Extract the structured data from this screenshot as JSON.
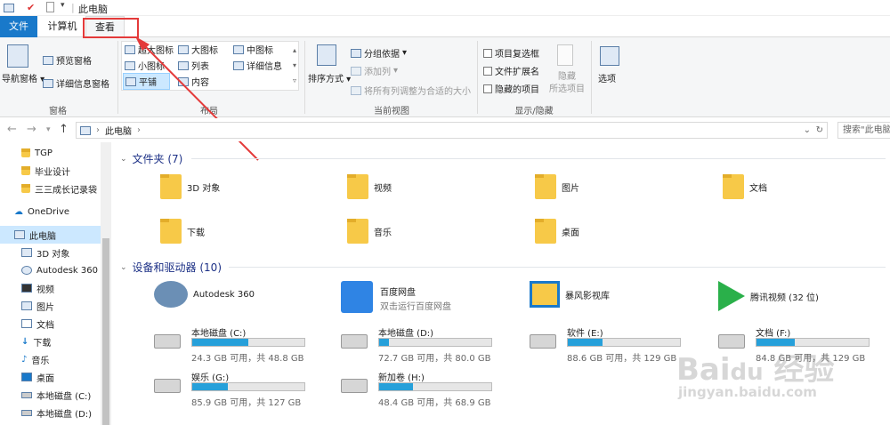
{
  "window": {
    "title": "此电脑"
  },
  "tabs": [
    {
      "label": "文件",
      "color": "#1979ca"
    },
    {
      "label": "计算机"
    },
    {
      "label": "查看"
    }
  ],
  "ribbon": {
    "pane": {
      "nav_pane": "导航窗格",
      "preview_pane": "预览窗格",
      "details_pane": "详细信息窗格",
      "label": "窗格"
    },
    "layout": {
      "items": [
        "超大图标",
        "大图标",
        "中图标",
        "小图标",
        "列表",
        "详细信息",
        "平铺",
        "内容"
      ],
      "label": "布局"
    },
    "current_view": {
      "sort_by": "排序方式",
      "group_by": "分组依据",
      "add_column": "添加列",
      "fit_columns": "将所有列调整为合适的大小",
      "label": "当前视图"
    },
    "show_hide": {
      "checkbox_items": "项目复选框",
      "extensions": "文件扩展名",
      "hidden_items": "隐藏的项目",
      "hide_selected_line1": "隐藏",
      "hide_selected_line2": "所选项目",
      "label": "显示/隐藏"
    },
    "options": "选项"
  },
  "address": {
    "path": "此电脑",
    "search_placeholder": "搜索\"此电脑\""
  },
  "sidebar": {
    "items": [
      {
        "label": "TGP"
      },
      {
        "label": "毕业设计"
      },
      {
        "label": "三三成长记录袋"
      },
      {
        "label": "OneDrive"
      },
      {
        "label": "此电脑"
      },
      {
        "label": "3D 对象"
      },
      {
        "label": "Autodesk 360"
      },
      {
        "label": "视频"
      },
      {
        "label": "图片"
      },
      {
        "label": "文档"
      },
      {
        "label": "下载"
      },
      {
        "label": "音乐"
      },
      {
        "label": "桌面"
      },
      {
        "label": "本地磁盘 (C:)"
      },
      {
        "label": "本地磁盘 (D:)"
      }
    ]
  },
  "folders": {
    "header": "文件夹 (7)",
    "items": [
      "3D 对象",
      "视频",
      "图片",
      "文档",
      "下载",
      "音乐",
      "桌面"
    ]
  },
  "devices": {
    "header": "设备和驱动器 (10)",
    "apps": [
      {
        "name": "Autodesk 360"
      },
      {
        "name": "百度网盘",
        "sub": "双击运行百度网盘"
      },
      {
        "name": "暴风影视库"
      },
      {
        "name": "腾讯视频 (32 位)"
      }
    ],
    "drives": [
      {
        "name": "本地磁盘 (C:)",
        "info": "24.3 GB 可用，共 48.8 GB",
        "used": 0.5
      },
      {
        "name": "本地磁盘 (D:)",
        "info": "72.7 GB 可用，共 80.0 GB",
        "used": 0.09
      },
      {
        "name": "软件 (E:)",
        "info": "88.6 GB 可用，共 129 GB",
        "used": 0.31
      },
      {
        "name": "文档 (F:)",
        "info": "84.8 GB 可用，共 129 GB",
        "used": 0.34
      },
      {
        "name": "娱乐 (G:)",
        "info": "85.9 GB 可用，共 127 GB",
        "used": 0.32
      },
      {
        "name": "新加卷 (H:)",
        "info": "48.4 GB 可用，共 68.9 GB",
        "used": 0.3
      }
    ]
  },
  "watermark": {
    "line1": "Bai 经验",
    "line2": "jingyan.baidu.com"
  }
}
